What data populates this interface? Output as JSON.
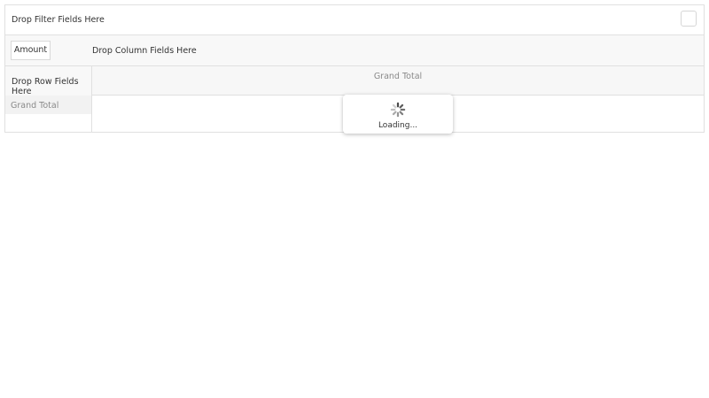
{
  "pivot": {
    "filter_placeholder": "Drop Filter Fields Here",
    "value_field": "Amount",
    "column_placeholder": "Drop Column Fields Here",
    "row_placeholder": "Drop Row Fields Here",
    "column_grand_total": "Grand Total",
    "row_grand_total": "Grand Total"
  },
  "loading": {
    "text": "Loading...",
    "icon": "spinner-icon"
  },
  "colors": {
    "border": "#e0e0e0",
    "header_background": "#f7f7f7",
    "muted_text": "#8a8a8a"
  }
}
